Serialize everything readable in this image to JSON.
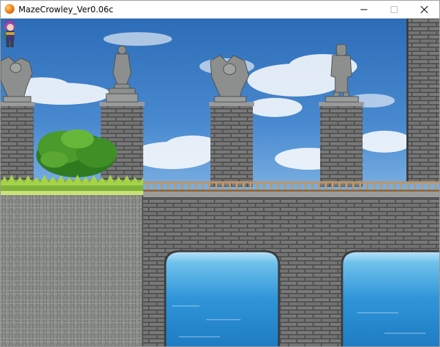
{
  "window": {
    "title": "MazeCrowley_Ver0.06c",
    "app_icon": "orange-orb-icon",
    "controls": {
      "minimize": "minimize-icon",
      "maximize": "maximize-icon",
      "close": "close-icon"
    }
  },
  "scene": {
    "sky_color": "#3f7fc4",
    "stone_color": "#6b6b6b",
    "sea_color": "#2f8fd0",
    "foliage_color": "#3f8f2a",
    "statues": [
      "gargoyle-statue",
      "goddess-statue",
      "gargoyle-statue",
      "knight-armor-statue"
    ],
    "player": "purple-haired-hero-sprite"
  }
}
